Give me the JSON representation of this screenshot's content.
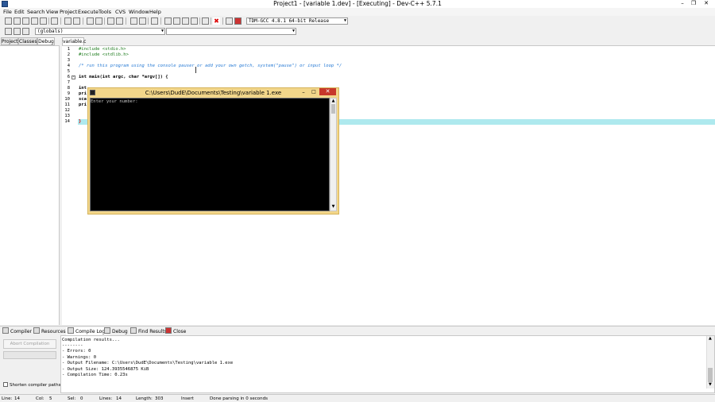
{
  "window": {
    "title": "Project1 - [variable 1.dev] - [Executing] - Dev-C++ 5.7.1"
  },
  "menu": [
    "File",
    "Edit",
    "Search",
    "View",
    "Project",
    "Execute",
    "Tools",
    "CVS",
    "Window",
    "Help"
  ],
  "toolbar": {
    "compiler": "TDM-GCC 4.8.1 64-bit Release",
    "scope": "(globals)"
  },
  "left_tabs": [
    "Project",
    "Classes",
    "Debug"
  ],
  "editor": {
    "tab": "variable.c",
    "line_numbers": [
      "1",
      "2",
      "3",
      "4",
      "5",
      "6",
      "7",
      "8",
      "9",
      "10",
      "11",
      "12",
      "13",
      "14"
    ],
    "lines": [
      "#include <stdio.h>",
      "#include <stdlib.h>",
      "",
      "/* run this program using the console pauser or add your own getch, system(\"pause\") or input loop */",
      "",
      "int main(int argc, char *argv[]) {",
      "",
      "int",
      "pri",
      "sca",
      "pri",
      "",
      "",
      "}"
    ]
  },
  "console": {
    "title": "C:\\Users\\DudE\\Documents\\Testing\\variable 1.exe",
    "output": "Enter your number:"
  },
  "bottom_tabs": [
    "Compiler",
    "Resources",
    "Compile Log",
    "Debug",
    "Find Results",
    "Close"
  ],
  "compile": {
    "abort_label": "Abort Compilation",
    "shorten_label": "Shorten compiler paths",
    "log": [
      "Compilation results...",
      "--------",
      "- Errors: 0",
      "- Warnings: 0",
      "- Output Filename: C:\\Users\\DudE\\Documents\\Testing\\variable 1.exe",
      "- Output Size: 124.3935546875 KiB",
      "- Compilation Time: 0.23s"
    ]
  },
  "status": {
    "line_label": "Line:",
    "line": "14",
    "col_label": "Col:",
    "col": "5",
    "sel_label": "Sel:",
    "sel": "0",
    "lines_label": "Lines:",
    "lines": "14",
    "length_label": "Length:",
    "length": "303",
    "mode": "Insert",
    "message": "Done parsing in 0 seconds"
  },
  "colors": {
    "console_frame": "#f2d68a",
    "line_highlight": "#aee9ee",
    "comment": "#2a7cd5",
    "preprocessor": "#1a7a1a"
  }
}
